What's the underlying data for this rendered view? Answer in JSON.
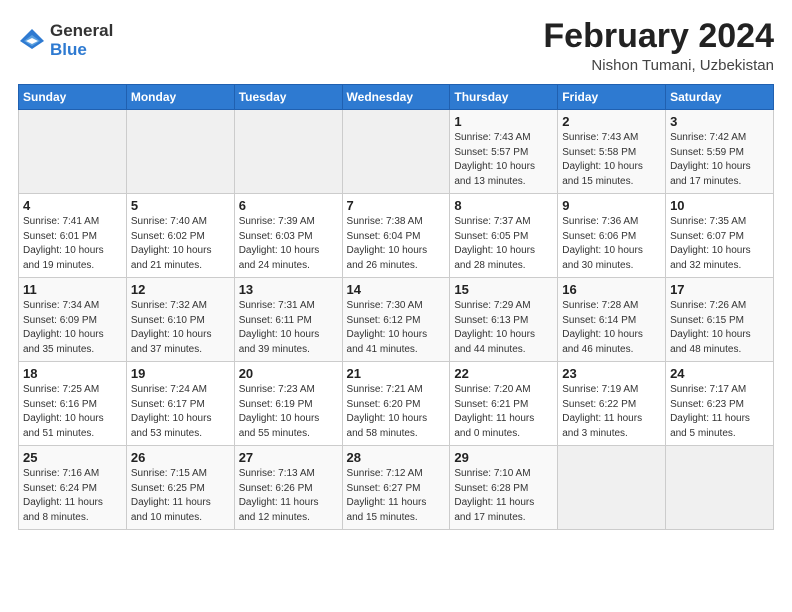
{
  "logo": {
    "general": "General",
    "blue": "Blue"
  },
  "title": "February 2024",
  "subtitle": "Nishon Tumani, Uzbekistan",
  "days_of_week": [
    "Sunday",
    "Monday",
    "Tuesday",
    "Wednesday",
    "Thursday",
    "Friday",
    "Saturday"
  ],
  "weeks": [
    [
      {
        "day": "",
        "info": ""
      },
      {
        "day": "",
        "info": ""
      },
      {
        "day": "",
        "info": ""
      },
      {
        "day": "",
        "info": ""
      },
      {
        "day": "1",
        "info": "Sunrise: 7:43 AM\nSunset: 5:57 PM\nDaylight: 10 hours\nand 13 minutes."
      },
      {
        "day": "2",
        "info": "Sunrise: 7:43 AM\nSunset: 5:58 PM\nDaylight: 10 hours\nand 15 minutes."
      },
      {
        "day": "3",
        "info": "Sunrise: 7:42 AM\nSunset: 5:59 PM\nDaylight: 10 hours\nand 17 minutes."
      }
    ],
    [
      {
        "day": "4",
        "info": "Sunrise: 7:41 AM\nSunset: 6:01 PM\nDaylight: 10 hours\nand 19 minutes."
      },
      {
        "day": "5",
        "info": "Sunrise: 7:40 AM\nSunset: 6:02 PM\nDaylight: 10 hours\nand 21 minutes."
      },
      {
        "day": "6",
        "info": "Sunrise: 7:39 AM\nSunset: 6:03 PM\nDaylight: 10 hours\nand 24 minutes."
      },
      {
        "day": "7",
        "info": "Sunrise: 7:38 AM\nSunset: 6:04 PM\nDaylight: 10 hours\nand 26 minutes."
      },
      {
        "day": "8",
        "info": "Sunrise: 7:37 AM\nSunset: 6:05 PM\nDaylight: 10 hours\nand 28 minutes."
      },
      {
        "day": "9",
        "info": "Sunrise: 7:36 AM\nSunset: 6:06 PM\nDaylight: 10 hours\nand 30 minutes."
      },
      {
        "day": "10",
        "info": "Sunrise: 7:35 AM\nSunset: 6:07 PM\nDaylight: 10 hours\nand 32 minutes."
      }
    ],
    [
      {
        "day": "11",
        "info": "Sunrise: 7:34 AM\nSunset: 6:09 PM\nDaylight: 10 hours\nand 35 minutes."
      },
      {
        "day": "12",
        "info": "Sunrise: 7:32 AM\nSunset: 6:10 PM\nDaylight: 10 hours\nand 37 minutes."
      },
      {
        "day": "13",
        "info": "Sunrise: 7:31 AM\nSunset: 6:11 PM\nDaylight: 10 hours\nand 39 minutes."
      },
      {
        "day": "14",
        "info": "Sunrise: 7:30 AM\nSunset: 6:12 PM\nDaylight: 10 hours\nand 41 minutes."
      },
      {
        "day": "15",
        "info": "Sunrise: 7:29 AM\nSunset: 6:13 PM\nDaylight: 10 hours\nand 44 minutes."
      },
      {
        "day": "16",
        "info": "Sunrise: 7:28 AM\nSunset: 6:14 PM\nDaylight: 10 hours\nand 46 minutes."
      },
      {
        "day": "17",
        "info": "Sunrise: 7:26 AM\nSunset: 6:15 PM\nDaylight: 10 hours\nand 48 minutes."
      }
    ],
    [
      {
        "day": "18",
        "info": "Sunrise: 7:25 AM\nSunset: 6:16 PM\nDaylight: 10 hours\nand 51 minutes."
      },
      {
        "day": "19",
        "info": "Sunrise: 7:24 AM\nSunset: 6:17 PM\nDaylight: 10 hours\nand 53 minutes."
      },
      {
        "day": "20",
        "info": "Sunrise: 7:23 AM\nSunset: 6:19 PM\nDaylight: 10 hours\nand 55 minutes."
      },
      {
        "day": "21",
        "info": "Sunrise: 7:21 AM\nSunset: 6:20 PM\nDaylight: 10 hours\nand 58 minutes."
      },
      {
        "day": "22",
        "info": "Sunrise: 7:20 AM\nSunset: 6:21 PM\nDaylight: 11 hours\nand 0 minutes."
      },
      {
        "day": "23",
        "info": "Sunrise: 7:19 AM\nSunset: 6:22 PM\nDaylight: 11 hours\nand 3 minutes."
      },
      {
        "day": "24",
        "info": "Sunrise: 7:17 AM\nSunset: 6:23 PM\nDaylight: 11 hours\nand 5 minutes."
      }
    ],
    [
      {
        "day": "25",
        "info": "Sunrise: 7:16 AM\nSunset: 6:24 PM\nDaylight: 11 hours\nand 8 minutes."
      },
      {
        "day": "26",
        "info": "Sunrise: 7:15 AM\nSunset: 6:25 PM\nDaylight: 11 hours\nand 10 minutes."
      },
      {
        "day": "27",
        "info": "Sunrise: 7:13 AM\nSunset: 6:26 PM\nDaylight: 11 hours\nand 12 minutes."
      },
      {
        "day": "28",
        "info": "Sunrise: 7:12 AM\nSunset: 6:27 PM\nDaylight: 11 hours\nand 15 minutes."
      },
      {
        "day": "29",
        "info": "Sunrise: 7:10 AM\nSunset: 6:28 PM\nDaylight: 11 hours\nand 17 minutes."
      },
      {
        "day": "",
        "info": ""
      },
      {
        "day": "",
        "info": ""
      }
    ]
  ]
}
